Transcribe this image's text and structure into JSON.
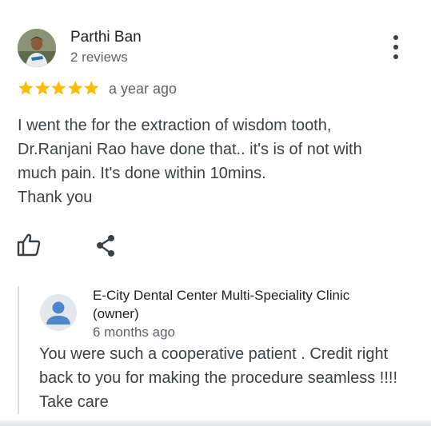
{
  "review": {
    "reviewer_name": "Parthi Ban",
    "reviewer_reviews": "2 reviews",
    "rating": 5,
    "rating_max": 5,
    "time": "a year ago",
    "text": "I went the for the extraction of wisdom tooth,\nDr.Ranjani Rao have done that.. it's is of not with\nmuch pain. It's done within 10mins.\nThank you"
  },
  "actions": {
    "like_icon": "thumb-up-outline-icon",
    "share_icon": "share-icon",
    "more_icon": "more-vert-icon"
  },
  "owner_reply": {
    "name": "E-City Dental Center Multi-Speciality Clinic (owner)",
    "time": "6 months ago",
    "text": "You were such a cooperative patient . Credit right back to you for making the procedure seamless !!!! Take care"
  },
  "colors": {
    "star": "#fbbc04",
    "owner_avatar_bg": "#e3e8ed",
    "owner_avatar_fg": "#4f86cb"
  }
}
